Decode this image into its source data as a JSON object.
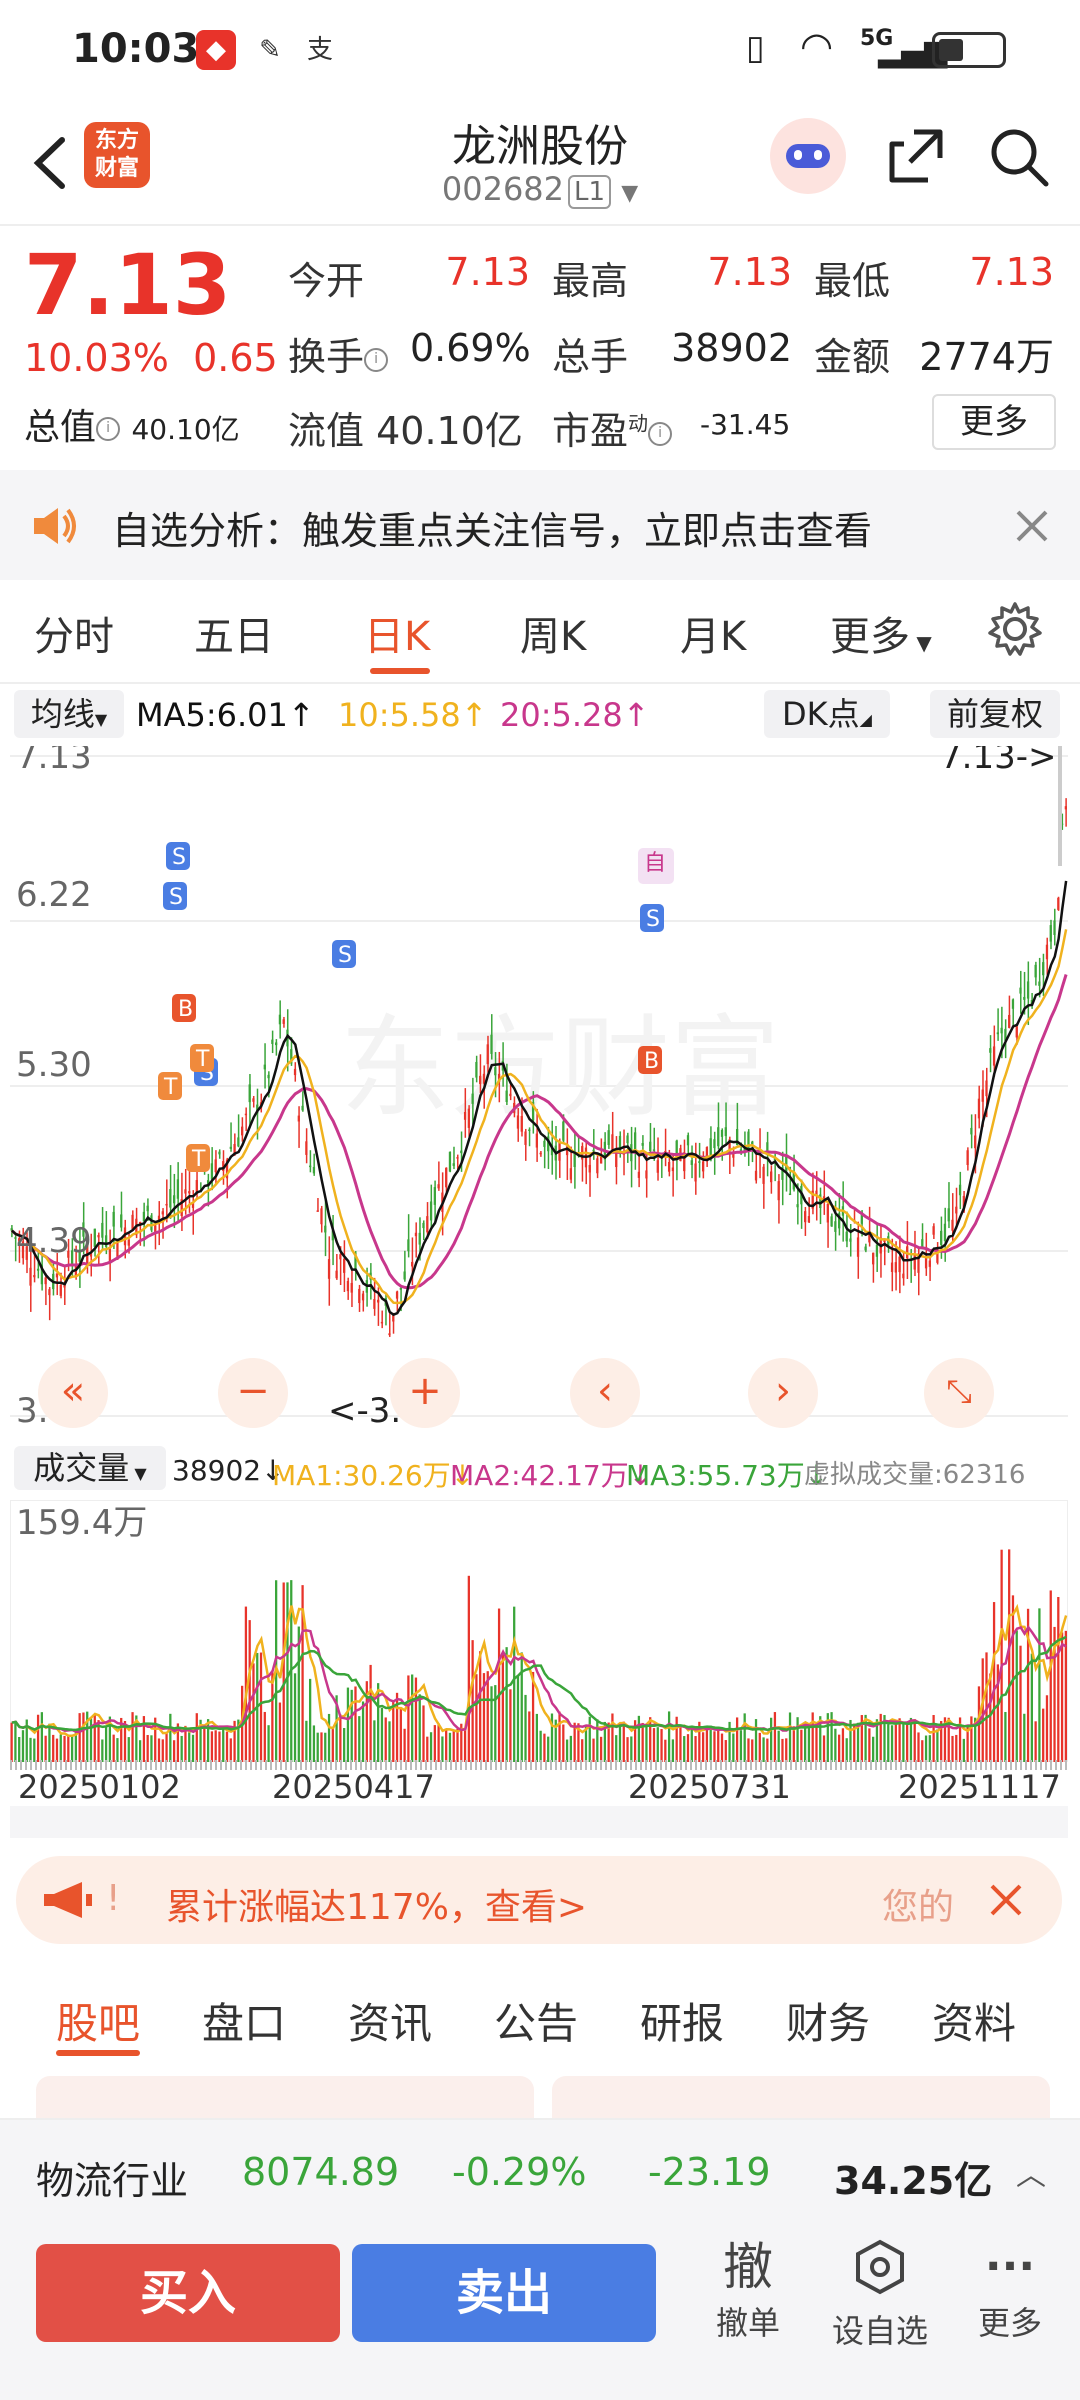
{
  "status": {
    "time": "10:03",
    "network": "5G"
  },
  "header": {
    "title": "龙洲股份",
    "code": "002682",
    "level": "L1"
  },
  "quote": {
    "price": "7.13",
    "change_pct": "10.03%",
    "change": "0.65",
    "open_label": "今开",
    "open": "7.13",
    "high_label": "最高",
    "high": "7.13",
    "low_label": "最低",
    "low": "7.13",
    "turnover_label": "换手",
    "turnover": "0.69%",
    "hands_label": "总手",
    "hands": "38902",
    "amount_label": "金额",
    "amount": "2774万",
    "mktcap_label": "总值",
    "mktcap": "40.10亿",
    "float_label": "流值",
    "float": "40.10亿",
    "pe_label": "市盈",
    "pe_sup": "动",
    "pe": "-31.45",
    "more": "更多"
  },
  "alert": {
    "text": "自选分析：触发重点关注信号，立即点击查看"
  },
  "tabs": [
    "分时",
    "五日",
    "日K",
    "周K",
    "月K",
    "更多"
  ],
  "ma": {
    "label": "均线",
    "ma5": "MA5:6.01",
    "ma10": "10:5.58",
    "ma20": "20:5.28",
    "dk": "DK点",
    "fq": "前复权"
  },
  "price_axis": {
    "top": "7.13",
    "l2": "6.22",
    "l3": "5.30",
    "l4": "4.39",
    "bottom": "3.47",
    "last": "7.13->",
    "min_label": "<-3.47"
  },
  "markers": {
    "s": "S",
    "b": "B",
    "t": "T",
    "self": "自"
  },
  "volume": {
    "label": "成交量",
    "value": "38902",
    "ma1": "MA1:30.26万",
    "ma2": "MA2:42.17万",
    "ma3": "MA3:55.73万",
    "virtual": "虚拟成交量:62316",
    "max": "159.4万"
  },
  "dates": [
    "20250102",
    "20250417",
    "20250731",
    "20251117"
  ],
  "promo": {
    "text": "累计涨幅达117%，查看>",
    "prefix": "!",
    "tail": "您的"
  },
  "bottom_tabs": [
    "股吧",
    "盘口",
    "资讯",
    "公告",
    "研报",
    "财务",
    "资料"
  ],
  "industry": {
    "name": "物流行业",
    "index": "8074.89",
    "pct": "-0.29%",
    "change": "-23.19",
    "amount": "34.25亿"
  },
  "footer": {
    "buy": "买入",
    "sell": "卖出",
    "cancel_icon": "撤",
    "cancel": "撤单",
    "watch": "设自选",
    "more": "更多"
  },
  "colors": {
    "up": "#e8332a",
    "down": "#3aa53a",
    "accent": "#e8542c",
    "ma5": "#111111",
    "ma10": "#f0b21e",
    "ma20": "#c8378c",
    "sell": "#4a7de3"
  }
}
